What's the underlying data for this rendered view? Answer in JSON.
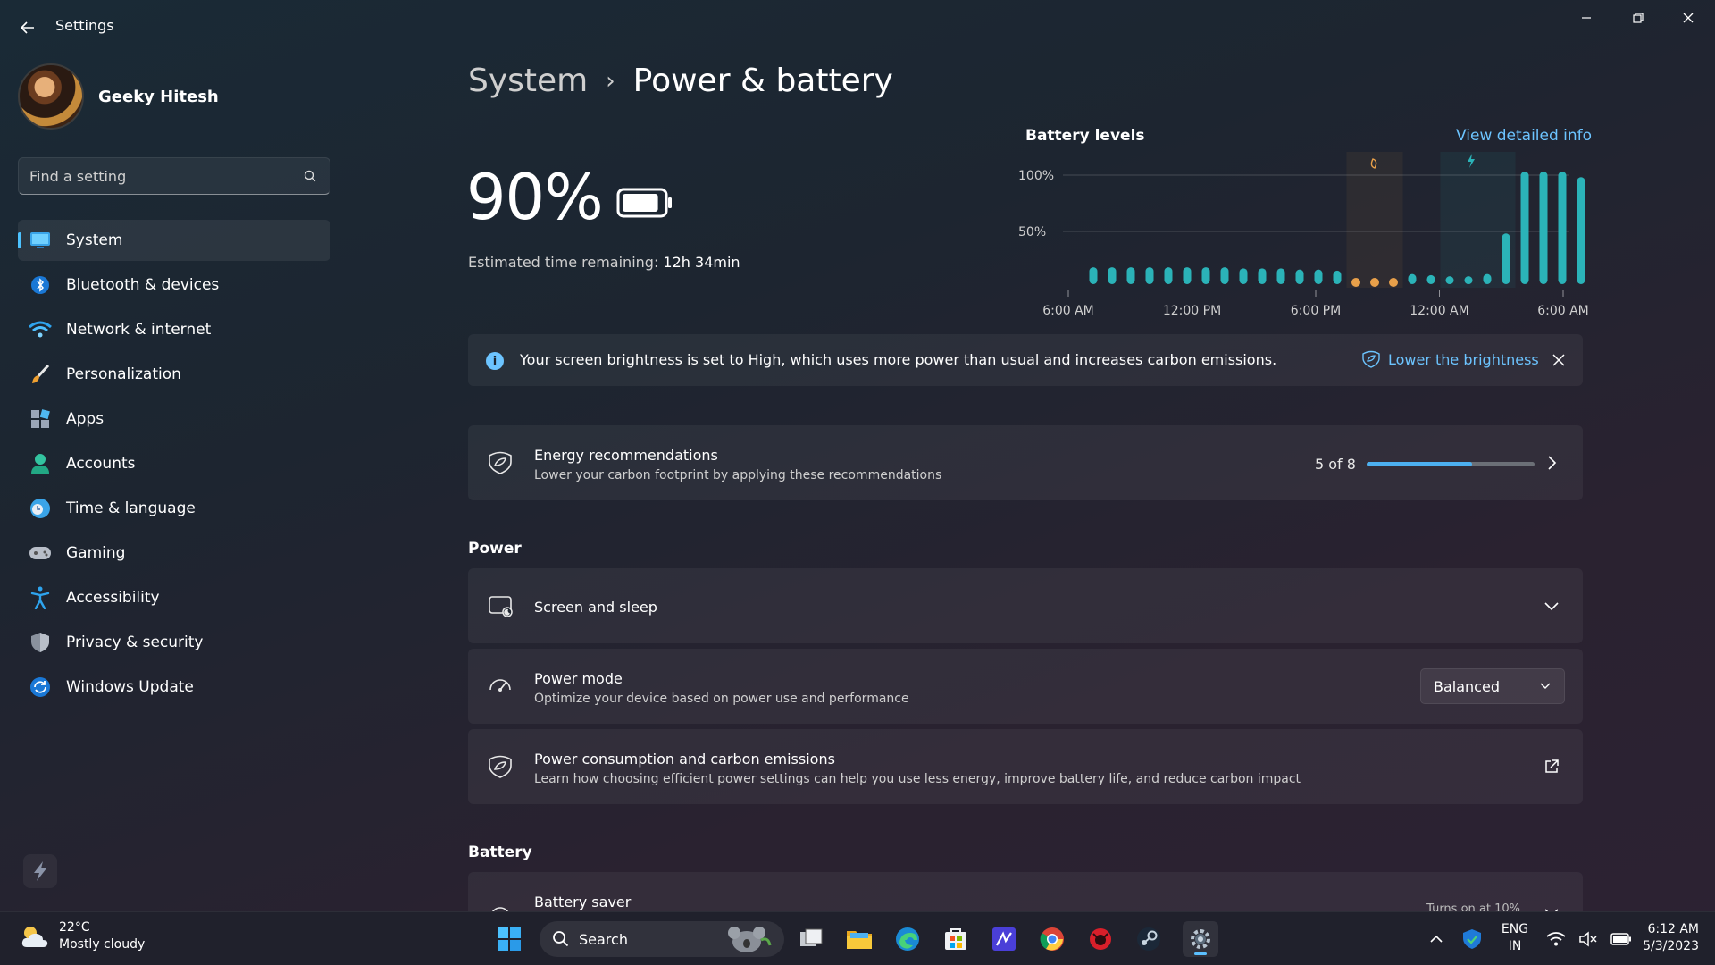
{
  "window": {
    "title": "Settings"
  },
  "user": {
    "name": "Geeky Hitesh"
  },
  "search": {
    "placeholder": "Find a setting"
  },
  "sidebar": {
    "items": [
      {
        "label": "System",
        "icon": "system-icon",
        "active": true
      },
      {
        "label": "Bluetooth & devices",
        "icon": "bluetooth-icon"
      },
      {
        "label": "Network & internet",
        "icon": "wifi-icon"
      },
      {
        "label": "Personalization",
        "icon": "brush-icon"
      },
      {
        "label": "Apps",
        "icon": "apps-icon"
      },
      {
        "label": "Accounts",
        "icon": "accounts-icon"
      },
      {
        "label": "Time & language",
        "icon": "clock-globe-icon"
      },
      {
        "label": "Gaming",
        "icon": "gamepad-icon"
      },
      {
        "label": "Accessibility",
        "icon": "accessibility-icon"
      },
      {
        "label": "Privacy & security",
        "icon": "shield-icon"
      },
      {
        "label": "Windows Update",
        "icon": "update-icon"
      }
    ]
  },
  "breadcrumb": {
    "parent": "System",
    "separator": "›",
    "current": "Power & battery"
  },
  "battery": {
    "percent": "90%",
    "level": 0.9,
    "estimate_label": "Estimated time remaining:",
    "estimate_value": "12h 34min"
  },
  "chart_data": {
    "type": "bar",
    "title": "Battery levels",
    "link": "View detailed info",
    "yticks": [
      "100%",
      "50%"
    ],
    "ylim": [
      0,
      100
    ],
    "xticks": [
      "6:00 AM",
      "12:00 PM",
      "6:00 PM",
      "12:00 AM",
      "6:00 AM"
    ],
    "values": [
      15,
      15,
      15,
      15,
      15,
      15,
      15,
      15,
      14,
      14,
      14,
      13,
      13,
      12,
      11,
      9,
      9,
      9,
      8,
      7,
      7,
      9,
      45,
      100,
      100,
      100,
      95
    ],
    "saver_range": [
      14,
      16
    ],
    "charging_range": [
      19,
      22
    ],
    "saver_color": "#e8a04a",
    "bar_color": "#2bb3b8"
  },
  "info_bar": {
    "text": "Your screen brightness is set to High, which uses more power than usual and increases carbon emissions.",
    "action": "Lower the brightness"
  },
  "energy": {
    "title": "Energy recommendations",
    "subtitle": "Lower your carbon footprint by applying these recommendations",
    "count": "5 of 8",
    "progress": 0.625
  },
  "sections": {
    "power": "Power",
    "battery": "Battery"
  },
  "power": {
    "screen_sleep": {
      "title": "Screen and sleep"
    },
    "power_mode": {
      "title": "Power mode",
      "subtitle": "Optimize your device based on power use and performance",
      "value": "Balanced"
    },
    "carbon": {
      "title": "Power consumption and carbon emissions",
      "subtitle": "Learn how choosing efficient power settings can help you use less energy, improve battery life, and reduce carbon impact"
    }
  },
  "battery_saver": {
    "title": "Battery saver",
    "status": "Turns on at 10%"
  },
  "taskbar": {
    "weather_temp": "22°C",
    "weather_desc": "Mostly cloudy",
    "search_label": "Search",
    "lang_1": "ENG",
    "lang_2": "IN",
    "time": "6:12 AM",
    "date": "5/3/2023"
  },
  "colors": {
    "accent": "#4cc2ff",
    "link": "#6cc4ff",
    "progress": "#4cb0f0"
  }
}
